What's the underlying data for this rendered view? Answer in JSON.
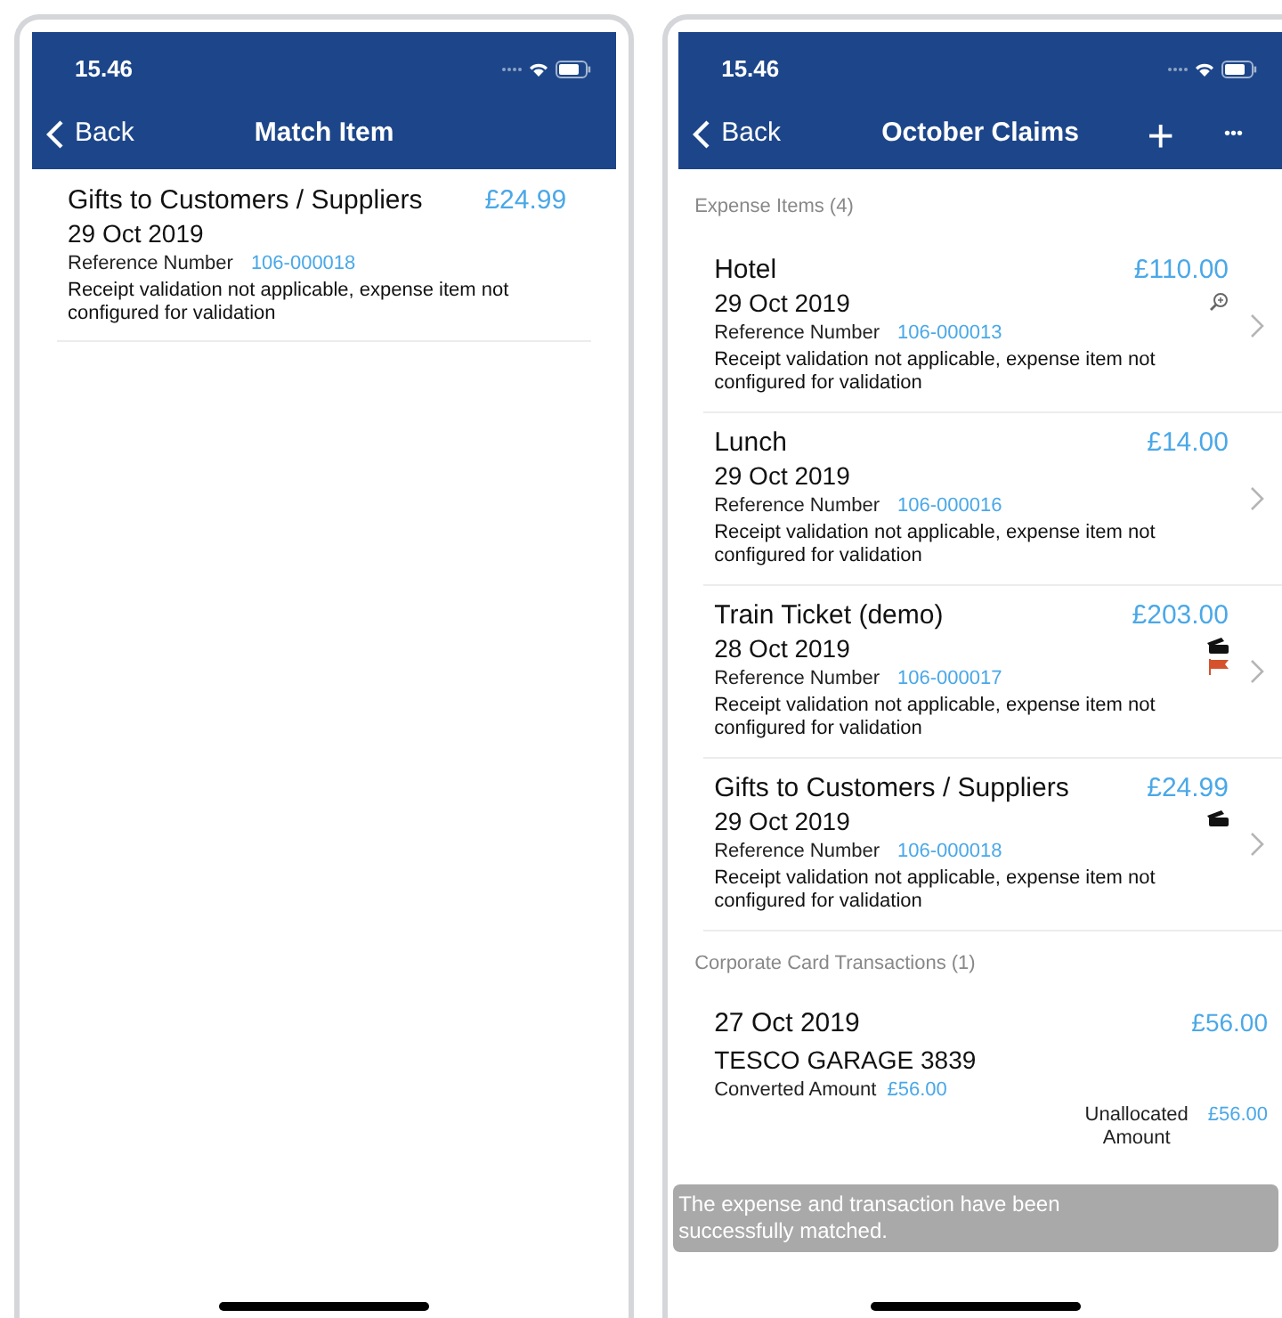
{
  "left_screen": {
    "status_bar": {
      "time": "15.46"
    },
    "nav": {
      "back": "Back",
      "title": "Match Item"
    },
    "item": {
      "title": "Gifts to Customers / Suppliers",
      "amount": "£24.99",
      "date": "29 Oct 2019",
      "ref_label": "Reference Number",
      "ref": "106-000018",
      "note": "Receipt validation not applicable, expense item not configured for validation"
    }
  },
  "right_screen": {
    "status_bar": {
      "time": "15.46"
    },
    "nav": {
      "back": "Back",
      "title": "October Claims",
      "add": "+",
      "more": "•••"
    },
    "expense_header": "Expense Items (4)",
    "expense_items": [
      {
        "title": "Hotel",
        "amount": "£110.00",
        "date": "29 Oct 2019",
        "ref_label": "Reference Number",
        "ref": "106-000013",
        "note": "Receipt validation not applicable, expense item not configured for validation",
        "receipt": true,
        "card": false,
        "flagged": false
      },
      {
        "title": "Lunch",
        "amount": "£14.00",
        "date": "29 Oct 2019",
        "ref_label": "Reference Number",
        "ref": "106-000016",
        "note": "Receipt validation not applicable, expense item not configured for validation",
        "receipt": false,
        "card": false,
        "flagged": false
      },
      {
        "title": "Train Ticket (demo)",
        "amount": "£203.00",
        "date": "28 Oct 2019",
        "ref_label": "Reference Number",
        "ref": "106-000017",
        "note": "Receipt validation not applicable, expense item not configured for validation",
        "receipt": false,
        "card": true,
        "flagged": true
      },
      {
        "title": "Gifts to Customers / Suppliers",
        "amount": "£24.99",
        "date": "29 Oct 2019",
        "ref_label": "Reference Number",
        "ref": "106-000018",
        "note": "Receipt validation not applicable, expense item not configured for validation",
        "receipt": false,
        "card": true,
        "flagged": false
      }
    ],
    "card_header": "Corporate Card Transactions (1)",
    "transactions": [
      {
        "date": "27 Oct 2019",
        "amount": "£56.00",
        "merchant": "TESCO GARAGE 3839",
        "converted_label": "Converted Amount",
        "converted": "£56.00",
        "unallocated_label": "Unallocated Amount",
        "unallocated": "£56.00"
      }
    ],
    "toast": "The expense and transaction have been successfully matched."
  }
}
